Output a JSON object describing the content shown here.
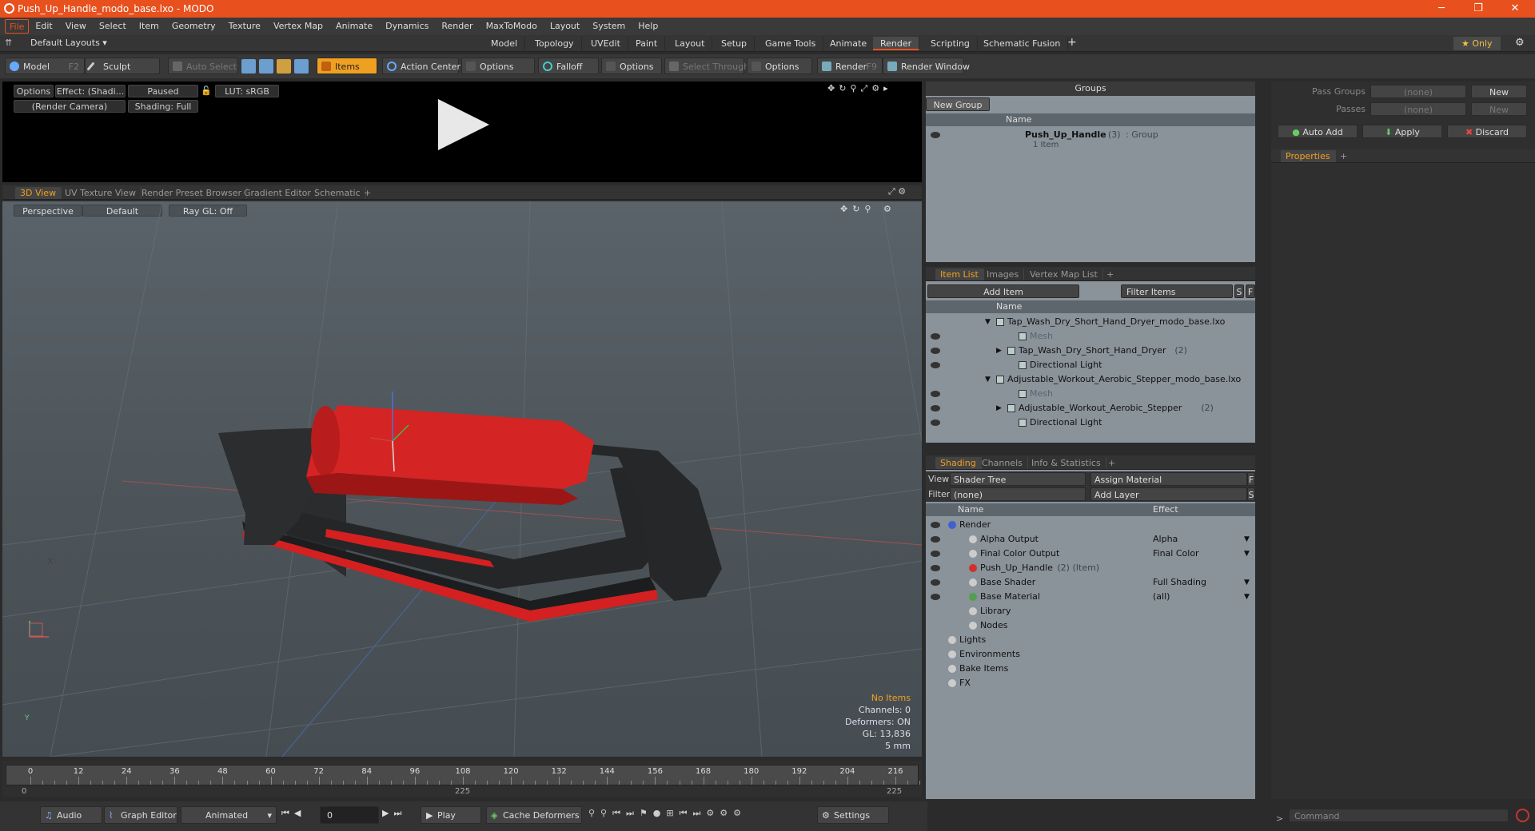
{
  "window": {
    "title": "Push_Up_Handle_modo_base.lxo - MODO",
    "min": "─",
    "max": "❐",
    "close": "✕"
  },
  "menu": [
    "File",
    "Edit",
    "View",
    "Select",
    "Item",
    "Geometry",
    "Texture",
    "Vertex Map",
    "Animate",
    "Dynamics",
    "Render",
    "MaxToModo",
    "Layout",
    "System",
    "Help"
  ],
  "layout": {
    "default_layouts": "Default Layouts ▾",
    "tabs": [
      "Model",
      "Topology",
      "UVEdit",
      "Paint",
      "Layout",
      "Setup",
      "Game Tools",
      "Animate",
      "Render",
      "Scripting",
      "Schematic Fusion"
    ],
    "plus": "+",
    "only": "★ Only",
    "gear": "⚙"
  },
  "toolbar": {
    "model": "Model",
    "model_key": "F2",
    "sculpt": "Sculpt",
    "auto_select": "Auto Select",
    "items": "Items",
    "action_center": "Action Center",
    "options1": "Options",
    "falloff": "Falloff",
    "options2": "Options",
    "select_through": "Select Through",
    "options3": "Options",
    "render": "Render",
    "render_key": "F9",
    "render_window": "Render Window"
  },
  "preview": {
    "options": "Options",
    "effect": "Effect: (Shadi...",
    "paused": "Paused",
    "lut": "LUT: sRGB",
    "camera": "(Render Camera)",
    "shading": "Shading: Full"
  },
  "view_tabs": [
    "3D View",
    "UV Texture View",
    "Render Preset Browser",
    "Gradient Editor",
    "Schematic",
    "+"
  ],
  "viewport": {
    "perspective": "Perspective",
    "default": "Default",
    "raygl": "Ray GL: Off",
    "stats": {
      "no_items": "No Items",
      "channels": "Channels: 0",
      "deformers": "Deformers: ON",
      "gl": "GL: 13,836",
      "unit": "5 mm"
    },
    "axis_x": "X",
    "axis_y": "Y"
  },
  "timeline": {
    "ticks": [
      "0",
      "12",
      "24",
      "36",
      "48",
      "60",
      "72",
      "84",
      "96",
      "108",
      "120",
      "132",
      "144",
      "156",
      "168",
      "180",
      "192",
      "204",
      "216"
    ],
    "sub_left": "0",
    "sub_mid": "225",
    "sub_right": "225"
  },
  "bottom": {
    "audio": "Audio",
    "graph_editor": "Graph Editor",
    "animated": "Animated",
    "frame": "0",
    "play": "Play",
    "cache": "Cache Deformers",
    "settings": "Settings"
  },
  "groups": {
    "title": "Groups",
    "new_group": "New Group",
    "col_name": "Name",
    "item_name": "Push_Up_Handle",
    "item_count": "(3)",
    "item_type": ": Group",
    "item_sub": "1 Item"
  },
  "itemlist": {
    "tabs": [
      "Item List",
      "Images",
      "Vertex Map List",
      "+"
    ],
    "add_item": "Add Item",
    "filter": "Filter Items",
    "s": "S",
    "f": "F",
    "col_name": "Name",
    "rows": [
      {
        "t": "Tap_Wash_Dry_Short_Hand_Dryer_modo_base.lxo",
        "ind": 0,
        "arrow": "▼",
        "dim": false
      },
      {
        "t": "Mesh",
        "ind": 2,
        "arrow": "",
        "dim": true
      },
      {
        "t": "Tap_Wash_Dry_Short_Hand_Dryer",
        "extra": "(2)",
        "ind": 1,
        "arrow": "▶",
        "dim": false
      },
      {
        "t": "Directional Light",
        "ind": 2,
        "arrow": "",
        "dim": false
      },
      {
        "t": "Adjustable_Workout_Aerobic_Stepper_modo_base.lxo",
        "ind": 0,
        "arrow": "▼",
        "dim": false
      },
      {
        "t": "Mesh",
        "ind": 2,
        "arrow": "",
        "dim": true
      },
      {
        "t": "Adjustable_Workout_Aerobic_Stepper",
        "extra": "(2)",
        "ind": 1,
        "arrow": "▶",
        "dim": false
      },
      {
        "t": "Directional Light",
        "ind": 2,
        "arrow": "",
        "dim": false
      }
    ]
  },
  "shading": {
    "tabs": [
      "Shading",
      "Channels",
      "Info & Statistics",
      "+"
    ],
    "view_label": "View",
    "view_val": "Shader Tree",
    "assign": "Assign Material",
    "filter_label": "Filter",
    "filter_val": "(none)",
    "add_layer": "Add Layer",
    "f": "F",
    "s": "S",
    "col_name": "Name",
    "col_effect": "Effect",
    "rows": [
      {
        "t": "Render",
        "e": "",
        "ind": 0
      },
      {
        "t": "Alpha Output",
        "e": "Alpha",
        "ind": 1
      },
      {
        "t": "Final Color Output",
        "e": "Final Color",
        "ind": 1
      },
      {
        "t": "Push_Up_Handle",
        "extra": "(2) (Item)",
        "e": "",
        "ind": 1
      },
      {
        "t": "Base Shader",
        "e": "Full Shading",
        "ind": 1
      },
      {
        "t": "Base Material",
        "e": "(all)",
        "ind": 1
      },
      {
        "t": "Library",
        "e": "",
        "ind": 1
      },
      {
        "t": "Nodes",
        "e": "",
        "ind": 1
      },
      {
        "t": "Lights",
        "e": "",
        "ind": 0
      },
      {
        "t": "Environments",
        "e": "",
        "ind": 0
      },
      {
        "t": "Bake Items",
        "e": "",
        "ind": 0
      },
      {
        "t": "FX",
        "e": "",
        "ind": 0
      }
    ]
  },
  "right": {
    "pass_groups": "Pass Groups",
    "passes": "Passes",
    "none1": "(none)",
    "none2": "(none)",
    "new1": "New",
    "new2": "New",
    "auto_add": "Auto Add",
    "apply": "Apply",
    "discard": "Discard",
    "properties": "Properties",
    "plus": "+",
    "command": "Command",
    "prompt": ">"
  }
}
